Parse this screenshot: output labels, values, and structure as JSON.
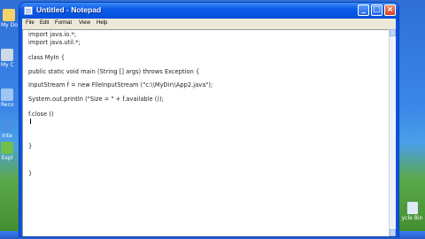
{
  "desktop": {
    "icon_labels": [
      "My Do",
      "My C",
      "Reco",
      "Inte",
      "Expl"
    ],
    "recycle_bin_label": "ycle Bin"
  },
  "window": {
    "title": "Untitled - Notepad",
    "menu": [
      "File",
      "Edit",
      "Format",
      "View",
      "Help"
    ],
    "buttons": {
      "minimize": "_",
      "maximize": "□",
      "close": "×"
    }
  },
  "editor": {
    "lines": [
      "import java.io.*;",
      "import java.util.*;",
      "",
      "class MyIn {",
      "",
      "public static void main (String [] args) throws Exception {",
      "",
      "InputStream f = new FileInputStream (\"c:\\\\MyDir\\\\App2.java\");",
      "",
      "System.out.println (\"Size = \" + f.available ());",
      "",
      "f.close ()",
      "",
      "",
      "",
      "}",
      "",
      "",
      "",
      "",
      "}"
    ]
  },
  "colors": {
    "titlebar": "#0b5bea",
    "editor_bg": "#ffffff",
    "menubar_bg": "#ece9d8"
  }
}
